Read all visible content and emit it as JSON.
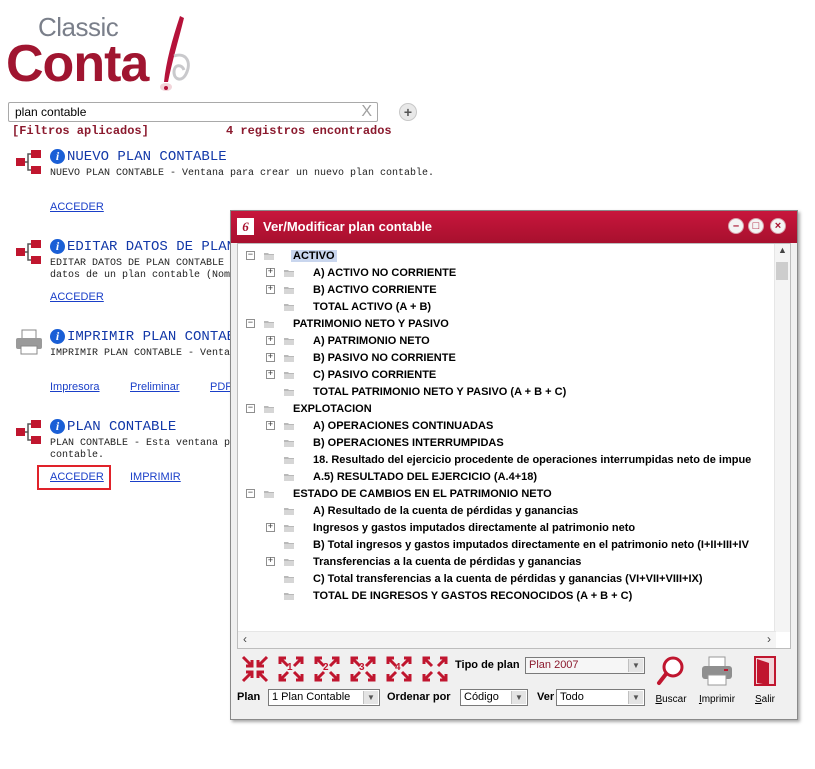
{
  "logo": {
    "small": "Classic",
    "big": "Conta",
    "mark": "6"
  },
  "search": {
    "value": "plan contable",
    "clear": "X",
    "add": "+"
  },
  "filters_label": "[Filtros aplicados]",
  "results_count": "4 registros encontrados",
  "items": [
    {
      "title": "NUEVO PLAN CONTABLE",
      "desc": [
        "NUEVO PLAN CONTABLE - Ventana para crear un nuevo plan contable."
      ],
      "links": [
        "ACCEDER"
      ]
    },
    {
      "title": "EDITAR DATOS DE PLAN",
      "desc": [
        "EDITAR DATOS DE PLAN CONTABLE",
        "datos de un plan contable (Nom"
      ],
      "links": [
        "ACCEDER"
      ]
    },
    {
      "title": "IMPRIMIR PLAN CONTAB",
      "desc": [
        "IMPRIMIR PLAN CONTABLE - Venta"
      ],
      "links": [
        "Impresora",
        "Preliminar",
        "PDF"
      ]
    },
    {
      "title": "PLAN CONTABLE",
      "desc": [
        "PLAN CONTABLE - Esta ventana p",
        "contable."
      ],
      "links": [
        "ACCEDER",
        "IMPRIMIR"
      ]
    }
  ],
  "window": {
    "icon": "6",
    "title": "Ver/Modificar plan contable",
    "buttons": {
      "minimize": "–",
      "maximize": "□",
      "close": "×"
    },
    "tree": [
      {
        "label": "ACTIVO",
        "level": 0,
        "expander": "−",
        "selected": true
      },
      {
        "label": "A) ACTIVO NO CORRIENTE",
        "level": 1,
        "expander": "+"
      },
      {
        "label": "B) ACTIVO CORRIENTE",
        "level": 1,
        "expander": "+"
      },
      {
        "label": "TOTAL ACTIVO (A + B)",
        "level": 1,
        "expander": ""
      },
      {
        "label": "PATRIMONIO NETO Y PASIVO",
        "level": 0,
        "expander": "−"
      },
      {
        "label": "A) PATRIMONIO NETO",
        "level": 1,
        "expander": "+"
      },
      {
        "label": "B) PASIVO NO CORRIENTE",
        "level": 1,
        "expander": "+"
      },
      {
        "label": "C) PASIVO CORRIENTE",
        "level": 1,
        "expander": "+"
      },
      {
        "label": "TOTAL PATRIMONIO NETO Y PASIVO (A + B + C)",
        "level": 1,
        "expander": ""
      },
      {
        "label": "EXPLOTACION",
        "level": 0,
        "expander": "−"
      },
      {
        "label": "A) OPERACIONES CONTINUADAS",
        "level": 1,
        "expander": "+"
      },
      {
        "label": "B) OPERACIONES INTERRUMPIDAS",
        "level": 1,
        "expander": ""
      },
      {
        "label": "18. Resultado del ejercicio procedente de operaciones interrumpidas neto de impue",
        "level": 1,
        "expander": ""
      },
      {
        "label": "A.5) RESULTADO DEL EJERCICIO (A.4+18)",
        "level": 1,
        "expander": ""
      },
      {
        "label": "ESTADO DE CAMBIOS EN EL PATRIMONIO NETO",
        "level": 0,
        "expander": "−"
      },
      {
        "label": "A) Resultado de la cuenta de pérdidas y ganancias",
        "level": 1,
        "expander": ""
      },
      {
        "label": "Ingresos y gastos imputados directamente al patrimonio neto",
        "level": 1,
        "expander": "+"
      },
      {
        "label": "B) Total ingresos y gastos imputados directamente en el patrimonio neto (I+II+III+IV",
        "level": 1,
        "expander": ""
      },
      {
        "label": "Transferencias a la cuenta de pérdidas y ganancias",
        "level": 1,
        "expander": "+"
      },
      {
        "label": "C) Total transferencias a la cuenta de pérdidas y ganancias (VI+VII+VIII+IX)",
        "level": 1,
        "expander": ""
      },
      {
        "label": "TOTAL DE INGRESOS Y GASTOS RECONOCIDOS (A + B + C)",
        "level": 1,
        "expander": ""
      }
    ],
    "level_buttons": [
      "",
      "1",
      "2",
      "3",
      "4",
      ""
    ],
    "tipo_plan": {
      "label": "Tipo de plan",
      "value": "Plan 2007"
    },
    "plan": {
      "label": "Plan",
      "value": "1 Plan Contable"
    },
    "ordenar": {
      "label": "Ordenar por",
      "value": "Código"
    },
    "ver": {
      "label": "Ver",
      "value": "Todo"
    },
    "tools": [
      {
        "key": "B",
        "rest": "uscar"
      },
      {
        "key": "I",
        "rest": "mprimir"
      },
      {
        "key": "S",
        "rest": "alir"
      }
    ],
    "colors": {
      "titlebar": "#b5123a",
      "accent": "#a01530"
    }
  }
}
